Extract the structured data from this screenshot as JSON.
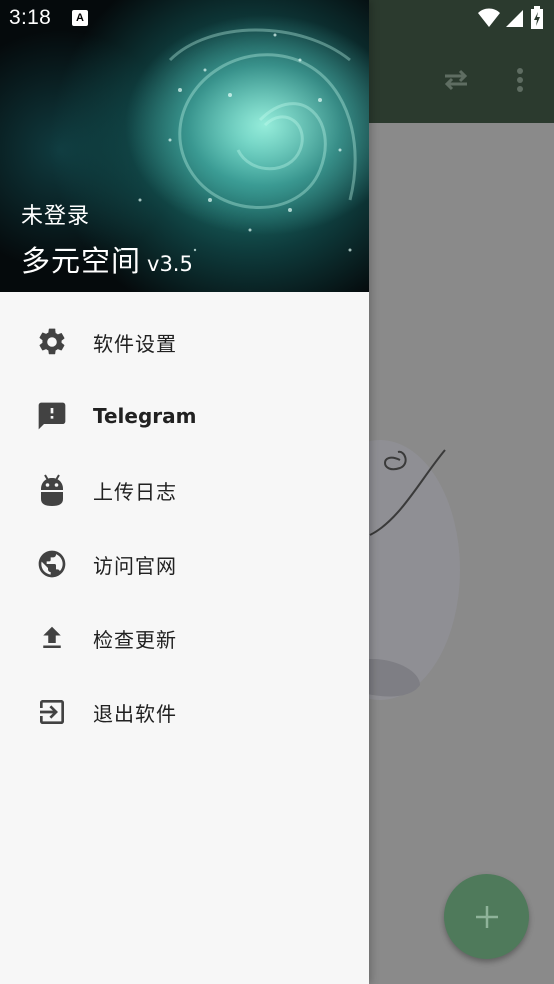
{
  "status_bar": {
    "time": "3:18",
    "notification_icon": "A",
    "icons": [
      "wifi-icon",
      "signal-icon",
      "battery-icon"
    ]
  },
  "background_app": {
    "toolbar_actions": [
      "swap-icon",
      "more-vert-icon"
    ],
    "fab_icon": "add-icon"
  },
  "drawer": {
    "header": {
      "login_status": "未登录",
      "app_name": "多元空间",
      "version": "v3.5"
    },
    "menu": [
      {
        "label": "软件设置",
        "icon": "gear-icon"
      },
      {
        "label": "Telegram",
        "icon": "feedback-icon"
      },
      {
        "label": "上传日志",
        "icon": "android-icon"
      },
      {
        "label": "访问官网",
        "icon": "globe-icon"
      },
      {
        "label": "检查更新",
        "icon": "upload-icon"
      },
      {
        "label": "退出软件",
        "icon": "exit-icon"
      }
    ]
  },
  "colors": {
    "icon": "#424242",
    "toolbar": "#2b3a2e",
    "fab": "#4f7a5b",
    "drawer_bg": "#f7f7f7"
  }
}
